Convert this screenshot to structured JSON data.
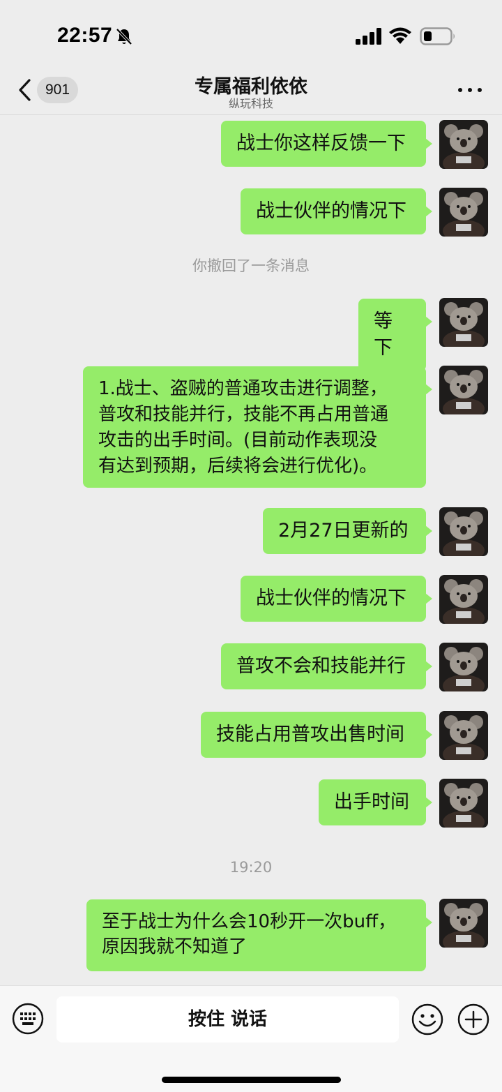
{
  "status_bar": {
    "time": "22:57",
    "icons": [
      "bell-slash-icon",
      "cellular-signal-icon",
      "wifi-icon",
      "battery-icon"
    ]
  },
  "nav": {
    "unread_count": "901",
    "title": "专属福利依依",
    "subtitle": "纵玩科技"
  },
  "messages": [
    {
      "type": "sent",
      "text": "战士你这样反馈一下"
    },
    {
      "type": "sent",
      "text": "战士伙伴的情况下"
    },
    {
      "type": "system",
      "text": "你撤回了一条消息"
    },
    {
      "type": "sent",
      "text": "等下"
    },
    {
      "type": "sent",
      "text": "1.战士、盗贼的普通攻击进行调整，\n普攻和技能并行，技能不再占用普通\n攻击的出手时间。(目前动作表现没\n有达到预期，后续将会进行优化)。"
    },
    {
      "type": "sent",
      "text": "2月27日更新的"
    },
    {
      "type": "sent",
      "text": "战士伙伴的情况下"
    },
    {
      "type": "sent",
      "text": "普攻不会和技能并行"
    },
    {
      "type": "sent",
      "text": "技能占用普攻出售时间"
    },
    {
      "type": "sent",
      "text": "出手时间"
    },
    {
      "type": "timestamp",
      "text": "19:20"
    },
    {
      "type": "sent",
      "text": "至于战士为什么会10秒开一次buff，\n原因我就不知道了"
    }
  ],
  "input_bar": {
    "hold_to_talk_label": "按住 说话"
  },
  "colors": {
    "background": "#ededed",
    "sent_bubble": "#95ec69",
    "system_text": "#9a9a9a"
  }
}
